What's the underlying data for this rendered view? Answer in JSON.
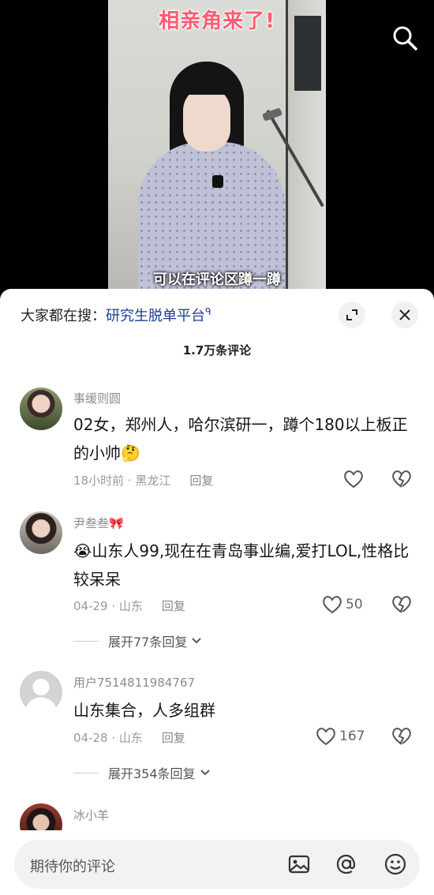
{
  "video": {
    "title": "相亲角来了!",
    "subtitle": "可以在评论区蹲一蹲"
  },
  "search_icon": "search-icon",
  "sheet": {
    "searching_prefix": "大家都在搜：",
    "searching_term": "研究生脱单平台",
    "searching_suffix": "ᑫ",
    "comment_count": "1.7万条评论"
  },
  "comments": [
    {
      "user": "事缓则圆",
      "text": "02女，郑州人，哈尔滨研一，蹲个180以上板正的小帅🤔",
      "time": "18小时前 · 黑龙江",
      "reply": "回复",
      "likes": ""
    },
    {
      "user": "尹叁叁🎀",
      "text": "😭山东人99,现在在青岛事业编,爱打LOL,性格比较呆呆",
      "time": "04-29 · 山东",
      "reply": "回复",
      "likes": "50",
      "expand": "展开77条回复"
    },
    {
      "user": "用户7514811984767",
      "text": "山东集合，人多组群",
      "time": "04-28 · 山东",
      "reply": "回复",
      "likes": "167",
      "expand": "展开354条回复"
    },
    {
      "user": "冰小羊"
    }
  ],
  "input": {
    "placeholder": "期待你的评论"
  }
}
